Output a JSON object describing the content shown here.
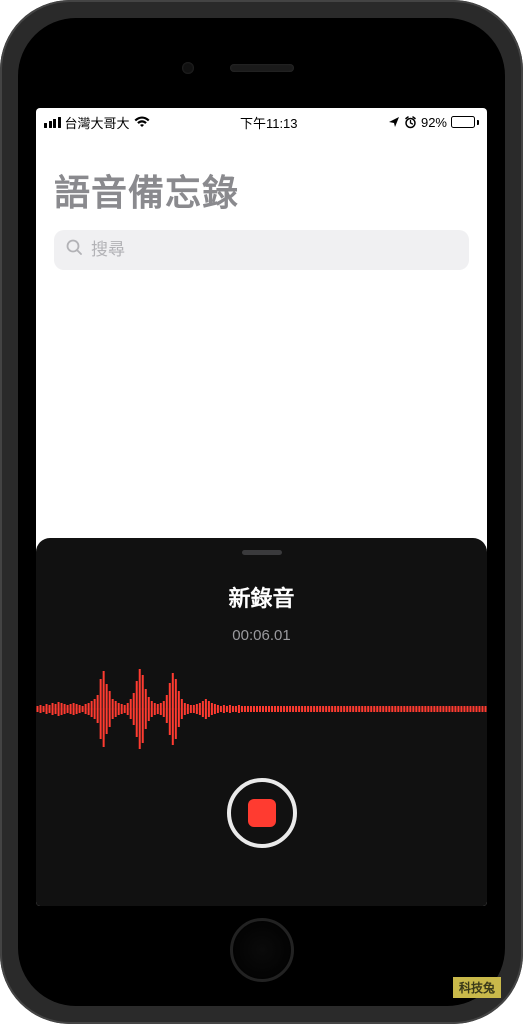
{
  "status": {
    "carrier": "台灣大哥大",
    "time": "下午11:13",
    "battery_pct": "92%",
    "battery_fill": 92
  },
  "header": {
    "title": "語音備忘錄"
  },
  "search": {
    "placeholder": "搜尋"
  },
  "recording": {
    "title": "新錄音",
    "time": "00:06.01"
  },
  "waveform": {
    "heights": [
      3,
      4,
      3,
      5,
      4,
      6,
      5,
      7,
      6,
      5,
      4,
      5,
      6,
      5,
      4,
      3,
      5,
      6,
      8,
      10,
      14,
      30,
      38,
      25,
      18,
      10,
      8,
      6,
      5,
      4,
      6,
      10,
      16,
      28,
      40,
      34,
      20,
      12,
      8,
      6,
      5,
      6,
      8,
      14,
      26,
      36,
      30,
      18,
      10,
      6,
      5,
      4,
      4,
      5,
      6,
      8,
      10,
      8,
      6,
      5,
      4,
      3,
      4,
      3,
      4,
      3,
      3,
      4,
      3,
      3,
      3,
      3,
      3,
      3,
      3,
      3,
      3,
      3,
      3,
      3,
      3,
      3,
      3,
      3,
      3,
      3,
      3,
      3,
      3,
      3,
      3,
      3,
      3,
      3,
      3,
      3,
      3,
      3,
      3,
      3,
      3,
      3,
      3,
      3,
      3,
      3,
      3,
      3,
      3,
      3,
      3,
      3,
      3,
      3,
      3,
      3,
      3,
      3,
      3,
      3,
      3,
      3,
      3,
      3,
      3,
      3,
      3,
      3,
      3,
      3,
      3,
      3,
      3,
      3,
      3,
      3,
      3,
      3,
      3,
      3,
      3,
      3,
      3,
      3,
      3,
      3,
      3,
      3,
      3,
      3
    ],
    "color": "#ff3b30"
  },
  "watermark": "科技兔"
}
